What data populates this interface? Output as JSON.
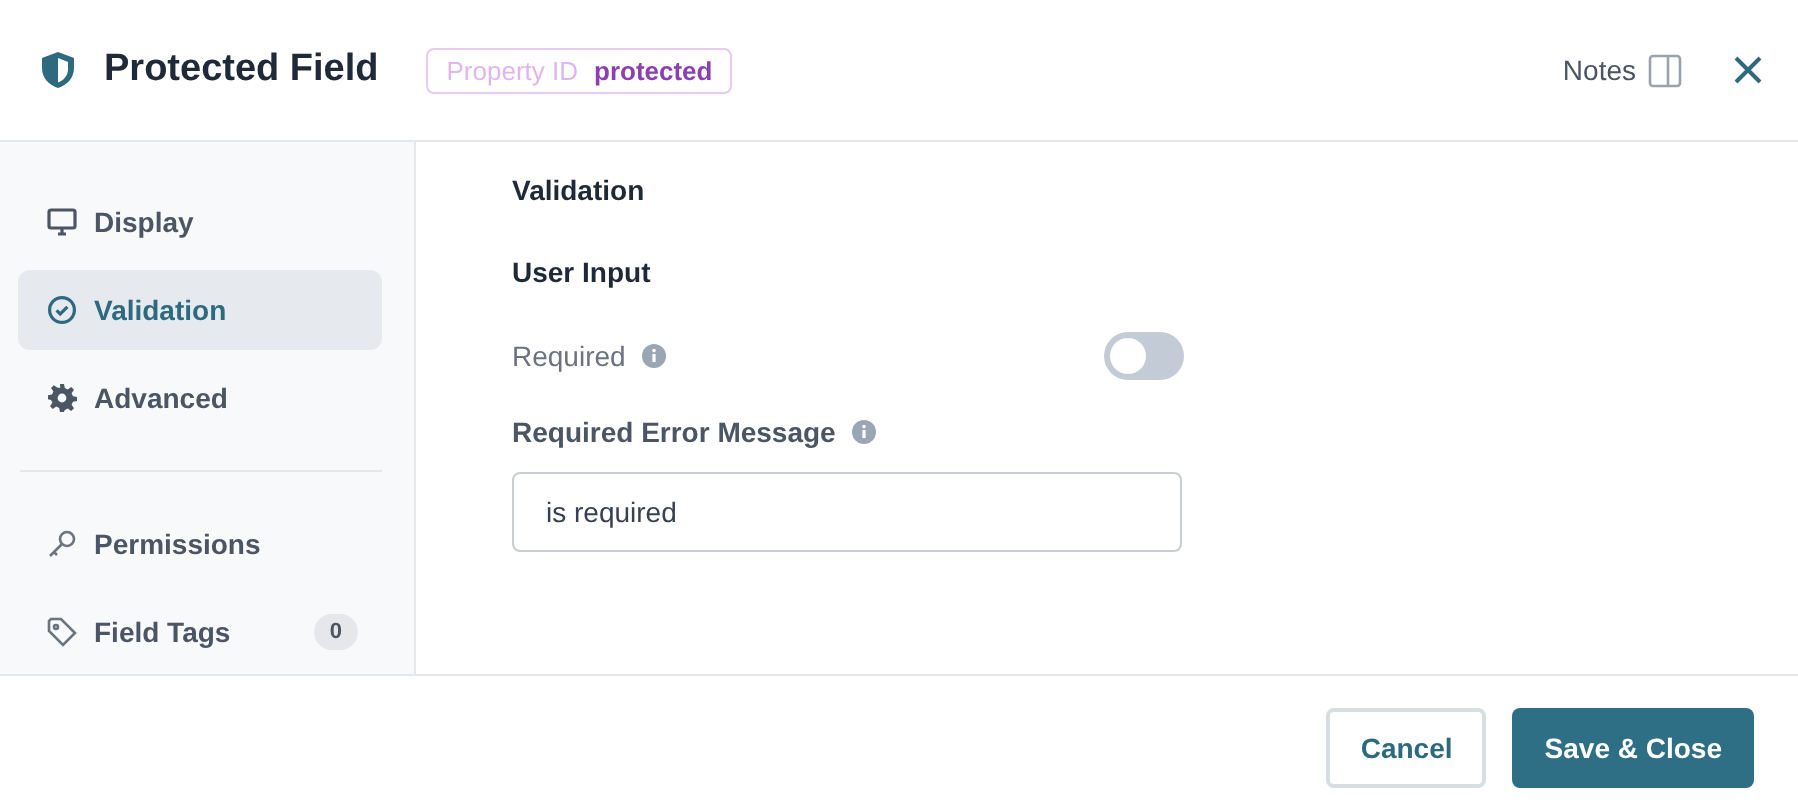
{
  "header": {
    "title": "Protected Field",
    "property_id": {
      "label": "Property ID",
      "value": "protected"
    },
    "notes_label": "Notes"
  },
  "sidebar": {
    "groups": [
      [
        {
          "label": "Display",
          "selected": false
        },
        {
          "label": "Validation",
          "selected": true
        },
        {
          "label": "Advanced",
          "selected": false
        }
      ],
      [
        {
          "label": "Permissions",
          "selected": false
        },
        {
          "label": "Field Tags",
          "selected": false,
          "badge": "0"
        }
      ]
    ]
  },
  "content": {
    "title": "Validation",
    "section": "User Input",
    "required": {
      "label": "Required",
      "on": false
    },
    "error_message": {
      "label": "Required Error Message",
      "value": "is required"
    }
  },
  "footer": {
    "buttons": [
      {
        "label": "Cancel",
        "kind": "secondary"
      },
      {
        "label": "Save & Close",
        "kind": "primary"
      }
    ]
  }
}
